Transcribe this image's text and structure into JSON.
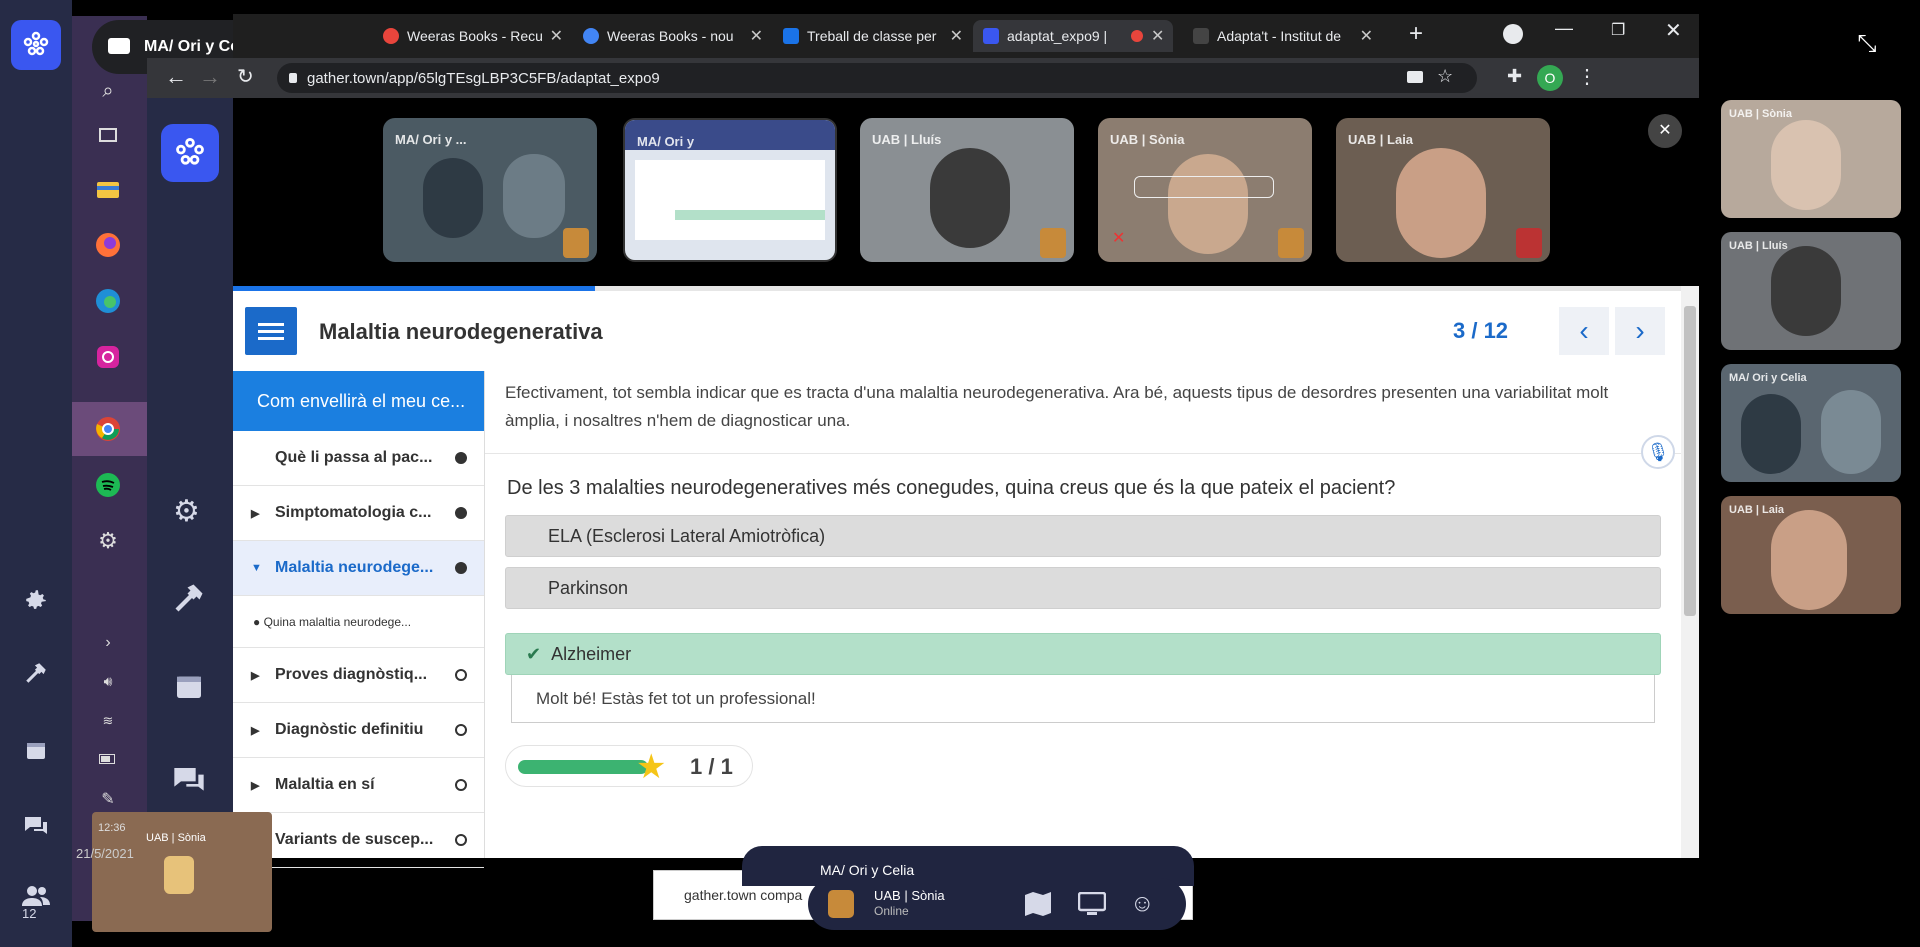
{
  "meeting_tab": {
    "title": "MA/ Ori y Celia 's sc..."
  },
  "browser": {
    "tabs": [
      {
        "label": "Weeras Books - Recu",
        "color": "#e8453c"
      },
      {
        "label": "Weeras Books - nou",
        "color": "#4285f4"
      },
      {
        "label": "Treball de classe per",
        "color": "#1a73e8"
      },
      {
        "label": "adaptat_expo9 |",
        "color": "#3a57f0"
      },
      {
        "label": "Adapta't - Institut de",
        "color": "#444444"
      }
    ],
    "active_tab": "adaptat_expo9 |",
    "url": "gather.town/app/65lgTEsgLBP3C5FB/adaptat_expo9",
    "profile_initial": "O"
  },
  "participants": [
    {
      "name": "MA/ Ori y ...",
      "bg": "#4b5a63"
    },
    {
      "name": "MA/ Ori y",
      "bg": "#dfe5ee"
    },
    {
      "name": "UAB | Lluís",
      "bg": "#8a8f93"
    },
    {
      "name": "UAB | Sònia",
      "bg": "#8c7d70"
    },
    {
      "name": "UAB | Laia",
      "bg": "#6c5e52"
    }
  ],
  "lesson": {
    "title": "Malaltia neurodegenerativa",
    "page": "3 / 12",
    "toc_header": "Com envellirà el meu ce...",
    "toc": [
      {
        "label": "Què li passa al pac...",
        "state": "done",
        "expand": ""
      },
      {
        "label": "Simptomatologia c...",
        "state": "done",
        "expand": "▶"
      },
      {
        "label": "Malaltia neurodege...",
        "state": "done",
        "expand": "▼",
        "active": true
      },
      {
        "label": "Proves diagnòstiq...",
        "state": "open",
        "expand": "▶"
      },
      {
        "label": "Diagnòstic definitiu",
        "state": "open",
        "expand": "▶"
      },
      {
        "label": "Malaltia en sí",
        "state": "open",
        "expand": "▶"
      },
      {
        "label": "Variants de suscep...",
        "state": "open",
        "expand": "▶"
      }
    ],
    "toc_sub": "Quina malaltia neurodege...",
    "intro": "Efectivament, tot sembla indicar que es tracta d'una malaltia neurodegenerativa. Ara bé, aquests tipus de desordres presenten una variabilitat molt àmplia, i nosaltres n'hem de diagnosticar una.",
    "question": "De les 3 malalties neurodegeneratives més conegudes, quina creus que és la que pateix el pacient?",
    "options": [
      "ELA (Esclerosi Lateral Amiotròfica)",
      "Parkinson",
      "Alzheimer"
    ],
    "correct_option": "Alzheimer",
    "feedback": "Molt bé! Estàs fet tot un professional!",
    "score": "1 / 1",
    "score_fraction": 1.0
  },
  "side_videos": [
    {
      "name": "UAB | Sònia",
      "bg": "#b7a99c"
    },
    {
      "name": "UAB | Lluís",
      "bg": "#6f7276"
    },
    {
      "name": "MA/ Ori y Celia",
      "bg": "#5a6670"
    },
    {
      "name": "UAB | Laia",
      "bg": "#7a5e4e"
    }
  ],
  "bottom": {
    "tooltip": "gather.town compa",
    "user_name": "UAB | Sònia",
    "user_status": "Online",
    "dock_title": "MA/ Ori y Celia",
    "mini_name": "UAB | Sònia",
    "clock": "12:36",
    "date": "21/5/2021",
    "people_count": "12"
  },
  "colors": {
    "accent": "#1b6ac9",
    "correct": "#b3e0c9",
    "gather": "#3a57f0"
  }
}
